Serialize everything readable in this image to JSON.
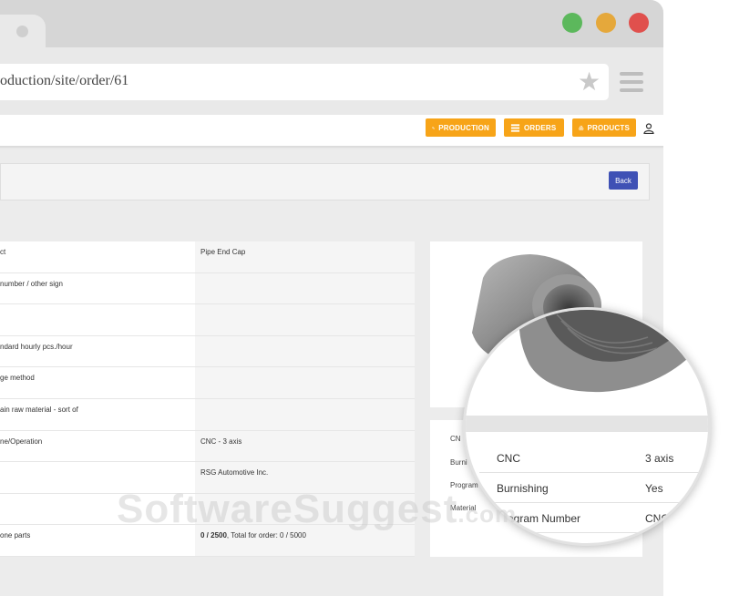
{
  "browser": {
    "url": "oduction/site/order/61",
    "colors": {
      "green": "#5cb85c",
      "yellow": "#e5a83b",
      "red": "#e0504d"
    }
  },
  "nav": {
    "production_label": "PRODUCTION",
    "orders_label": "ORDERS",
    "products_label": "PRODUCTS",
    "accent": "#f7a418"
  },
  "toolbar": {
    "back_label": "Back"
  },
  "table": {
    "rows": [
      {
        "label": "ct",
        "value": "Pipe End Cap"
      },
      {
        "label": "number / other sign",
        "value": ""
      },
      {
        "label": "",
        "value": ""
      },
      {
        "label": "ndard hourly pcs./hour",
        "value": ""
      },
      {
        "label": "ge method",
        "value": ""
      },
      {
        "label": "ain raw material - sort of",
        "value": ""
      },
      {
        "label": "ne/Operation",
        "value": "CNC - 3 axis"
      },
      {
        "label": "",
        "value": "RSG Automotive Inc."
      },
      {
        "label": "",
        "value": ""
      },
      {
        "label": "one parts",
        "value_bold": "0 / 2500",
        "value_rest": ", Total for order: 0 / 5000"
      }
    ]
  },
  "side": {
    "rows": [
      "CN",
      "Burni",
      "Program",
      "Material"
    ]
  },
  "magnifier": {
    "rows": [
      {
        "key": "CNC",
        "value": "3 axis"
      },
      {
        "key": "Burnishing",
        "value": "Yes"
      },
      {
        "key": "Program Number",
        "value": "CNC -"
      }
    ]
  },
  "watermark": {
    "main": "SoftwareSuggest",
    "suffix": ".com"
  }
}
